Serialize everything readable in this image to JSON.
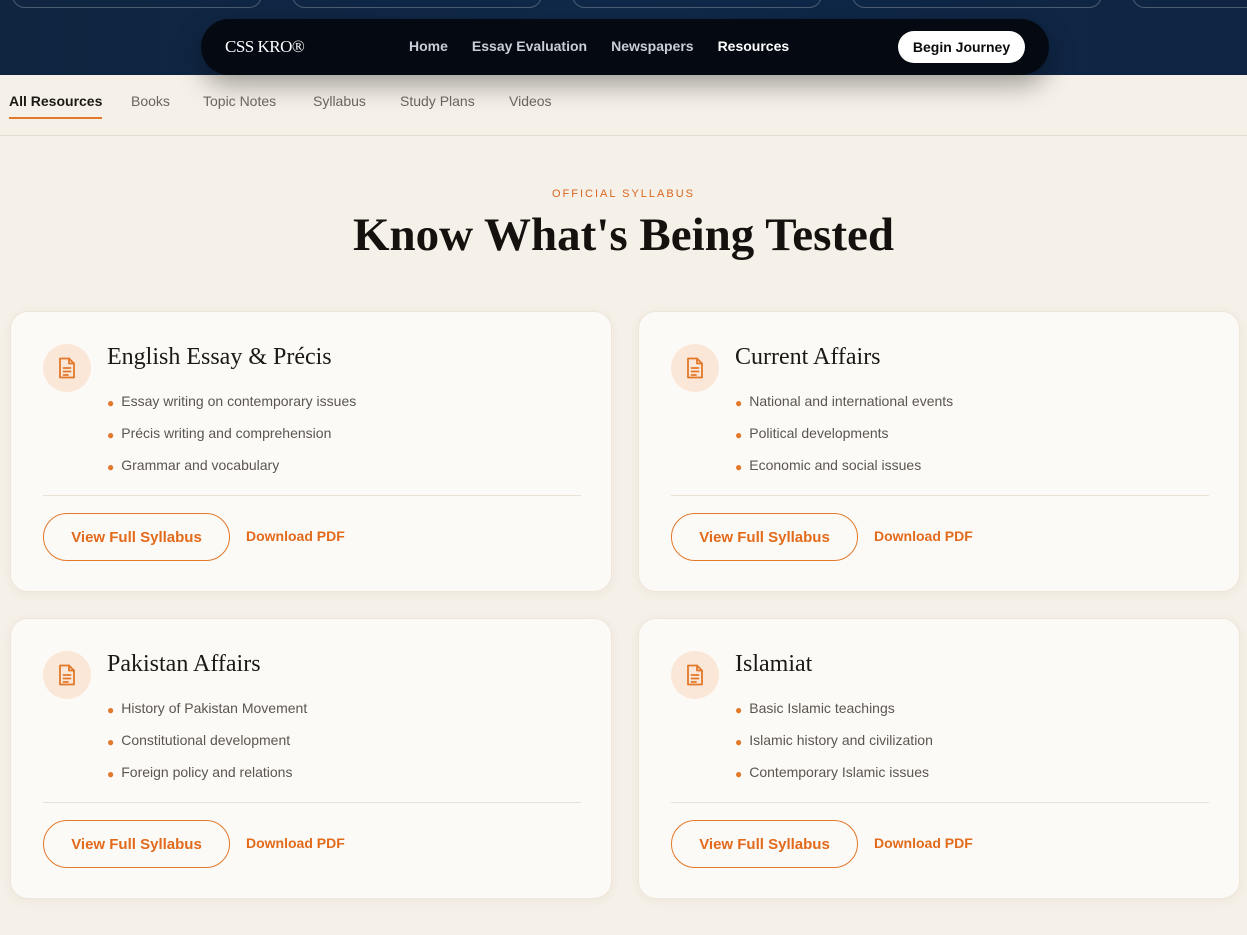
{
  "header": {
    "logo": "CSS KRO®",
    "nav": [
      {
        "label": "Home"
      },
      {
        "label": "Essay Evaluation"
      },
      {
        "label": "Newspapers"
      },
      {
        "label": "Resources"
      }
    ],
    "active_nav": "Resources",
    "cta_label": "Begin Journey"
  },
  "tabs": [
    {
      "label": "All Resources"
    },
    {
      "label": "Books"
    },
    {
      "label": "Topic Notes"
    },
    {
      "label": "Syllabus"
    },
    {
      "label": "Study Plans"
    },
    {
      "label": "Videos"
    }
  ],
  "active_tab": "All Resources",
  "section": {
    "eyebrow": "OFFICIAL SYLLABUS",
    "title": "Know What's Being Tested"
  },
  "cards": [
    {
      "title": "English Essay & Précis",
      "icon": "document-icon",
      "topics": [
        "Essay writing on contemporary issues",
        "Précis writing and comprehension",
        "Grammar and vocabulary"
      ],
      "primary_label": "View Full Syllabus",
      "secondary_label": "Download PDF"
    },
    {
      "title": "Current Affairs",
      "icon": "document-icon",
      "topics": [
        "National and international events",
        "Political developments",
        "Economic and social issues"
      ],
      "primary_label": "View Full Syllabus",
      "secondary_label": "Download PDF"
    },
    {
      "title": "Pakistan Affairs",
      "icon": "document-icon",
      "topics": [
        "History of Pakistan Movement",
        "Constitutional development",
        "Foreign policy and relations"
      ],
      "primary_label": "View Full Syllabus",
      "secondary_label": "Download PDF"
    },
    {
      "title": "Islamiat",
      "icon": "document-icon",
      "topics": [
        "Basic Islamic teachings",
        "Islamic history and civilization",
        "Contemporary Islamic issues"
      ],
      "primary_label": "View Full Syllabus",
      "secondary_label": "Download PDF"
    }
  ],
  "colors": {
    "accent": "#e2782a",
    "navy": "#0f2540",
    "navbar": "#050a12",
    "background": "#f5f0e8",
    "card": "#fcfaf7"
  }
}
